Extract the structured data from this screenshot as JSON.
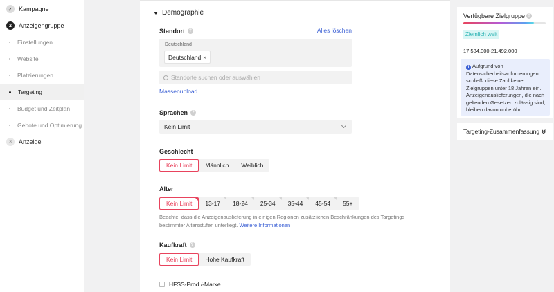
{
  "sidebar": {
    "steps": [
      {
        "icon": "check",
        "label": "Kampagne"
      },
      {
        "icon": "2",
        "label": "Anzeigengruppe"
      },
      {
        "icon": "3",
        "label": "Anzeige"
      }
    ],
    "subitems": [
      "Einstellungen",
      "Website",
      "Platzierungen",
      "Targeting",
      "Budget und Zeitplan",
      "Gebote und Optimierung"
    ]
  },
  "main": {
    "section_title": "Demographie",
    "standort": {
      "label": "Standort",
      "clear_all": "Alles löschen",
      "box_label": "Deutschland",
      "chip": "Deutschland",
      "search_placeholder": "Standorte suchen oder auswählen",
      "bulk_upload": "Massenupload"
    },
    "sprachen": {
      "label": "Sprachen",
      "value": "Kein Limit"
    },
    "geschlecht": {
      "label": "Geschlecht",
      "options": [
        "Kein Limit",
        "Männlich",
        "Weiblich"
      ],
      "selected": "Kein Limit"
    },
    "alter": {
      "label": "Alter",
      "options": [
        "Kein Limit",
        "13-17",
        "18-24",
        "25-34",
        "35-44",
        "45-54",
        "55+"
      ],
      "selected": "Kein Limit",
      "note": "Beachte, dass die Anzeigenauslieferung in einigen Regionen zusätzlichen Beschränkungen des Targetings bestimmter Altersstufen unterliegt.",
      "note_link": "Weitere Informationen"
    },
    "kaufkraft": {
      "label": "Kaufkraft",
      "options": [
        "Kein Limit",
        "Hohe Kaufkraft"
      ],
      "selected": "Kein Limit"
    },
    "hfss": {
      "label": "HFSS-Prod./-Marke",
      "checked": false
    }
  },
  "right": {
    "audience_title": "Verfügbare Zielgruppe",
    "badge": "Ziemlich weit",
    "range": "17,584,000-21,492,000",
    "info_text": "Aufgrund von Datensicherheitsanforderungen schließt diese Zahl keine Zielgruppen unter 18 Jahren ein. Anzeigenauslieferungen, die nach geltenden Gesetzen zulässig sind, bleiben davon unberührt.",
    "summary_title": "Targeting-Zusammenfassung"
  },
  "colors": {
    "accent": "#e8435d",
    "link": "#3a5fd4",
    "badge_bg": "#d9f6f5",
    "badge_text": "#2bb3b3",
    "info_bg": "#e9eefc"
  }
}
